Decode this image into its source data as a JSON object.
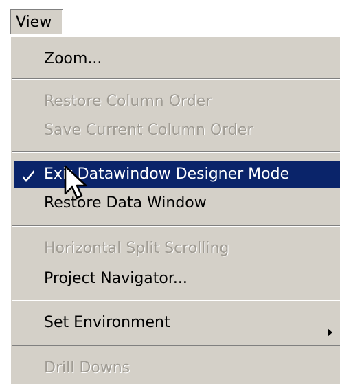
{
  "menubar": {
    "view_label": "View"
  },
  "menu": {
    "items": [
      {
        "label": "Zoom...",
        "enabled": true
      },
      {
        "label": "Restore Column Order",
        "enabled": false
      },
      {
        "label": "Save Current Column Order",
        "enabled": false
      },
      {
        "label": "Exit Datawindow Designer Mode",
        "enabled": true,
        "checked": true,
        "highlighted": true
      },
      {
        "label": "Restore Data Window",
        "enabled": true
      },
      {
        "label": "Horizontal Split Scrolling",
        "enabled": false
      },
      {
        "label": "Project Navigator...",
        "enabled": true
      },
      {
        "label": "Set Environment",
        "enabled": true,
        "submenu": true
      },
      {
        "label": "Drill Downs",
        "enabled": false
      }
    ]
  },
  "colors": {
    "menu_bg": "#d4d0c8",
    "highlight": "#0a246a",
    "disabled_text": "#a09c94"
  }
}
